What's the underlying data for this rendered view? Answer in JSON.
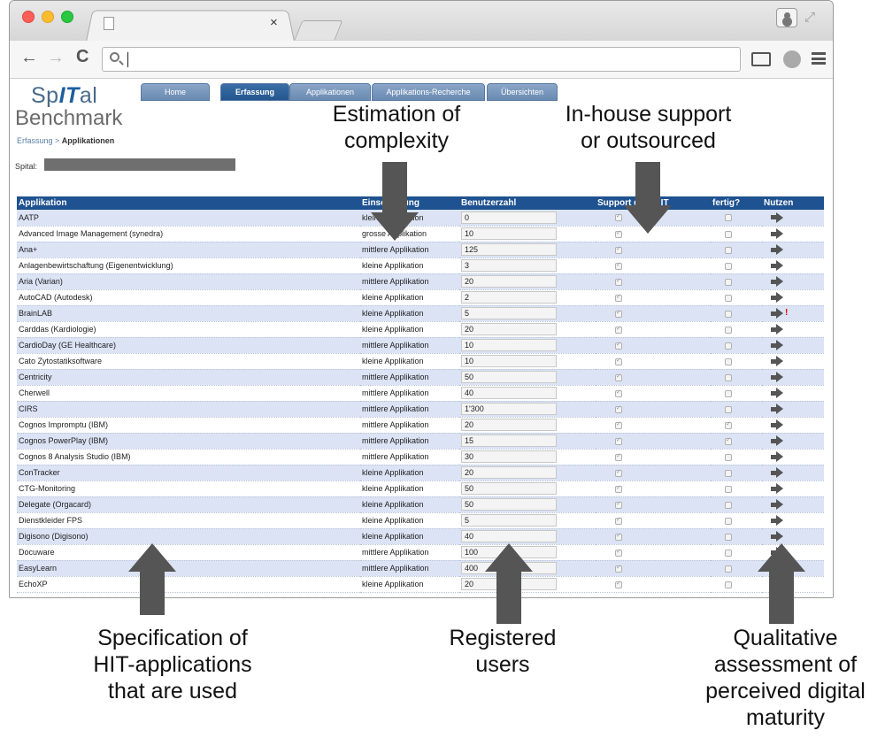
{
  "browser": {
    "tab_close": "×",
    "icons": [
      "close-dot",
      "minimize-dot",
      "maximize-dot",
      "back-icon",
      "forward-icon",
      "reload-icon",
      "search-icon",
      "cast-icon",
      "extension-icon",
      "menu-icon"
    ],
    "back": "←",
    "forward": "→",
    "reload": "C"
  },
  "app": {
    "logo_part1": "Sp",
    "logo_it": "IT",
    "logo_part2": "al",
    "logo_sub": "Benchmark",
    "breadcrumb_parent": "Erfassung",
    "breadcrumb_sep": " > ",
    "breadcrumb_current": "Applikationen",
    "spital_label": "Spital:"
  },
  "nav": [
    "Home",
    "Erfassung",
    "Applikationen",
    "Applikations-Recherche",
    "Übersichten"
  ],
  "nav_active": "Erfassung",
  "table": {
    "headers": [
      "Applikation",
      "Einschätzung",
      "Benutzerzahl",
      "Support durch IT",
      "fertig?",
      "Nutzen"
    ],
    "rows": [
      {
        "name": "AATP",
        "size": "kleine Applikation",
        "users": "0",
        "support": true,
        "done": false,
        "warn": ""
      },
      {
        "name": "Advanced Image Management (synedra)",
        "size": "grosse Applikation",
        "users": "10",
        "support": true,
        "done": false,
        "warn": ""
      },
      {
        "name": "Ana+",
        "size": "mittlere Applikation",
        "users": "125",
        "support": true,
        "done": false,
        "warn": ""
      },
      {
        "name": "Anlagenbewirtschaftung (Eigenentwicklung)",
        "size": "kleine Applikation",
        "users": "3",
        "support": true,
        "done": false,
        "warn": ""
      },
      {
        "name": "Aria (Varian)",
        "size": "mittlere Applikation",
        "users": "20",
        "support": true,
        "done": false,
        "warn": ""
      },
      {
        "name": "AutoCAD (Autodesk)",
        "size": "kleine Applikation",
        "users": "2",
        "support": true,
        "done": false,
        "warn": ""
      },
      {
        "name": "BrainLAB",
        "size": "kleine Applikation",
        "users": "5",
        "support": true,
        "done": false,
        "warn": "!"
      },
      {
        "name": "Carddas (Kardiologie)",
        "size": "kleine Applikation",
        "users": "20",
        "support": true,
        "done": false,
        "warn": ""
      },
      {
        "name": "CardioDay (GE Healthcare)",
        "size": "mittlere Applikation",
        "users": "10",
        "support": true,
        "done": false,
        "warn": ""
      },
      {
        "name": "Cato Zytostatiksoftware",
        "size": "kleine Applikation",
        "users": "10",
        "support": true,
        "done": false,
        "warn": ""
      },
      {
        "name": "Centricity",
        "size": "mittlere Applikation",
        "users": "50",
        "support": true,
        "done": false,
        "warn": ""
      },
      {
        "name": "Cherwell",
        "size": "mittlere Applikation",
        "users": "40",
        "support": true,
        "done": false,
        "warn": ""
      },
      {
        "name": "CIRS",
        "size": "mittlere Applikation",
        "users": "1'300",
        "support": true,
        "done": false,
        "warn": ""
      },
      {
        "name": "Cognos Impromptu (IBM)",
        "size": "mittlere Applikation",
        "users": "20",
        "support": true,
        "done": true,
        "warn": ""
      },
      {
        "name": "Cognos PowerPlay (IBM)",
        "size": "mittlere Applikation",
        "users": "15",
        "support": true,
        "done": true,
        "warn": ""
      },
      {
        "name": "Cognos 8 Analysis Studio (IBM)",
        "size": "mittlere Applikation",
        "users": "30",
        "support": true,
        "done": false,
        "warn": ""
      },
      {
        "name": "ConTracker",
        "size": "kleine Applikation",
        "users": "20",
        "support": true,
        "done": false,
        "warn": ""
      },
      {
        "name": "CTG-Monitoring",
        "size": "kleine Applikation",
        "users": "50",
        "support": true,
        "done": false,
        "warn": ""
      },
      {
        "name": "Delegate (Orgacard)",
        "size": "kleine Applikation",
        "users": "50",
        "support": true,
        "done": false,
        "warn": ""
      },
      {
        "name": "Dienstkleider FPS",
        "size": "kleine Applikation",
        "users": "5",
        "support": true,
        "done": false,
        "warn": ""
      },
      {
        "name": "Digisono (Digisono)",
        "size": "kleine Applikation",
        "users": "40",
        "support": true,
        "done": false,
        "warn": ""
      },
      {
        "name": "Docuware",
        "size": "mittlere Applikation",
        "users": "100",
        "support": true,
        "done": false,
        "warn": ""
      },
      {
        "name": "EasyLearn",
        "size": "mittlere Applikation",
        "users": "400",
        "support": true,
        "done": false,
        "warn": ""
      },
      {
        "name": "EchoXP",
        "size": "kleine Applikation",
        "users": "20",
        "support": true,
        "done": false,
        "warn": ""
      }
    ]
  },
  "annotations": {
    "complexity": "Estimation of\ncomplexity",
    "support": "In-house support\nor outsourced",
    "hit_apps": "Specification of\nHIT-applications\nthat are used",
    "registered": "Registered\nusers",
    "qualitative": "Qualitative\nassessment of\nperceived digital\nmaturity"
  },
  "colors": {
    "header_blue": "#1f5290",
    "row_alt": "#dbe3f5",
    "arrow_gray": "#555555"
  }
}
